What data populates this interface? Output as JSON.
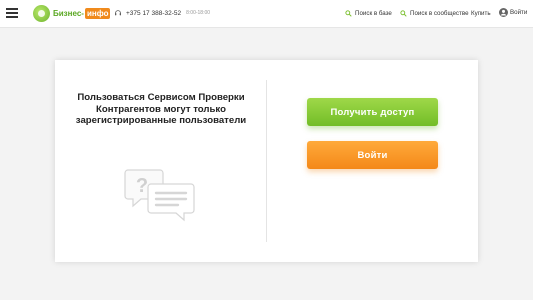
{
  "header": {
    "logo": {
      "text": "Бизнес-",
      "accent": "инфо"
    },
    "phone": {
      "number": "+375 17 388-32-52",
      "hours": "8:00-18:00"
    },
    "nav": {
      "search_base": "Поиск в базе",
      "search_community": "Поиск в сообществе",
      "buy": "Купить",
      "login": "Войти"
    }
  },
  "main": {
    "message": "Пользоваться Сервисом Проверки Контрагентов могут только зарегистрированные пользователи",
    "access_button": "Получить доступ",
    "login_button": "Войти"
  },
  "colors": {
    "brand_green": "#72bd27",
    "brand_orange": "#f48818",
    "background": "#f3f3f3"
  },
  "icons": [
    "menu-icon",
    "headset-icon",
    "search-icon",
    "user-icon",
    "chat-question-icon"
  ]
}
